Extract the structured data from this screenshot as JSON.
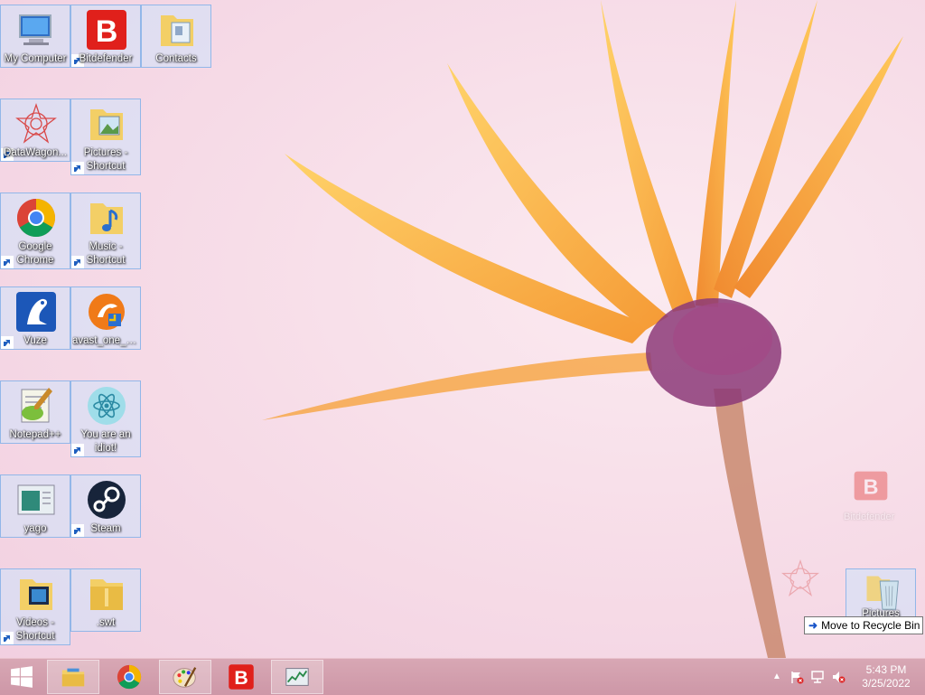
{
  "desktop": {
    "icons": [
      {
        "label": "My Computer"
      },
      {
        "label": "Bitdefender"
      },
      {
        "label": "Contacts"
      },
      {
        "label": "DataWagon..."
      },
      {
        "label": "Pictures - Shortcut"
      },
      {
        "label": "Google Chrome"
      },
      {
        "label": "Music - Shortcut"
      },
      {
        "label": "Vuze"
      },
      {
        "label": "avast_one_e..."
      },
      {
        "label": "Notepad++"
      },
      {
        "label": "You are an idiot!"
      },
      {
        "label": "yago"
      },
      {
        "label": "Steam"
      },
      {
        "label": "Videos - Shortcut"
      },
      {
        "label": ".swt"
      }
    ],
    "ghost_labels": {
      "a": "Bitdefender",
      "b": "Pictures"
    },
    "tooltip": "Move to Recycle Bin"
  },
  "taskbar": {
    "time": "5:43 PM",
    "date": "3/25/2022",
    "items": [
      "start-button",
      "file-explorer",
      "google-chrome",
      "paint",
      "bitdefender",
      "task-manager"
    ]
  },
  "colors": {
    "accent": "#cd97a7",
    "selection": "#cde4fc"
  }
}
